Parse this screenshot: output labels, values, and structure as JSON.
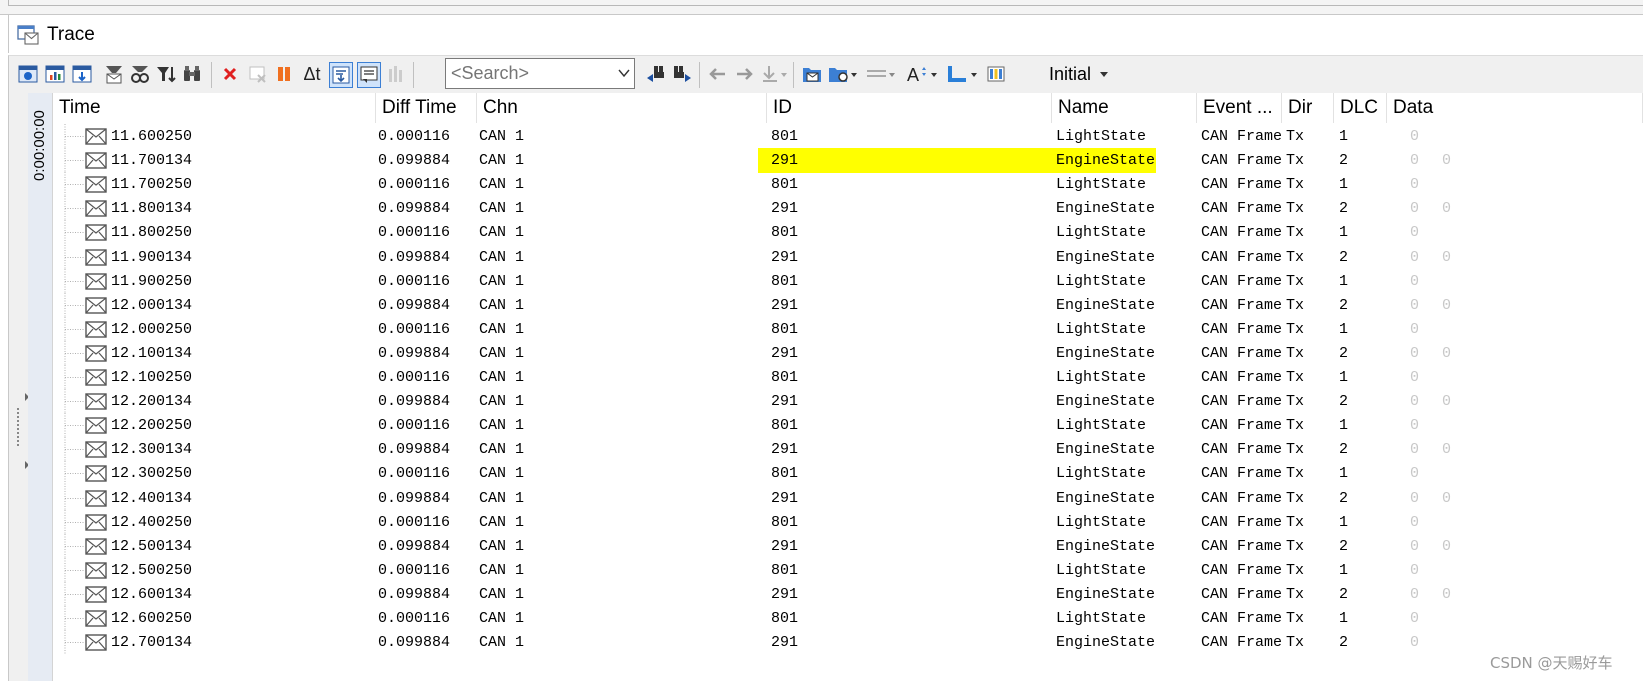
{
  "window": {
    "title": "Trace"
  },
  "toolbar": {
    "search_placeholder": "<Search>",
    "initial_label": "Initial",
    "delta_t_label": "Δt"
  },
  "time_strip": {
    "label": "0:00:00:00"
  },
  "columns": [
    "Time",
    "Diff Time",
    "Chn",
    "ID",
    "Name",
    "Event ...",
    "Dir",
    "DLC",
    "Data"
  ],
  "rows": [
    {
      "time": "11.600250",
      "diff": "0.000116",
      "chn": "CAN 1",
      "id": "801",
      "name": "LightState",
      "event": "CAN Frame",
      "dir": "Tx",
      "dlc": "1",
      "data": [
        "0"
      ],
      "highlight": false
    },
    {
      "time": "11.700134",
      "diff": "0.099884",
      "chn": "CAN 1",
      "id": "291",
      "name": "EngineState",
      "event": "CAN Frame",
      "dir": "Tx",
      "dlc": "2",
      "data": [
        "0",
        "0"
      ],
      "highlight": true
    },
    {
      "time": "11.700250",
      "diff": "0.000116",
      "chn": "CAN 1",
      "id": "801",
      "name": "LightState",
      "event": "CAN Frame",
      "dir": "Tx",
      "dlc": "1",
      "data": [
        "0"
      ],
      "highlight": false
    },
    {
      "time": "11.800134",
      "diff": "0.099884",
      "chn": "CAN 1",
      "id": "291",
      "name": "EngineState",
      "event": "CAN Frame",
      "dir": "Tx",
      "dlc": "2",
      "data": [
        "0",
        "0"
      ],
      "highlight": false
    },
    {
      "time": "11.800250",
      "diff": "0.000116",
      "chn": "CAN 1",
      "id": "801",
      "name": "LightState",
      "event": "CAN Frame",
      "dir": "Tx",
      "dlc": "1",
      "data": [
        "0"
      ],
      "highlight": false
    },
    {
      "time": "11.900134",
      "diff": "0.099884",
      "chn": "CAN 1",
      "id": "291",
      "name": "EngineState",
      "event": "CAN Frame",
      "dir": "Tx",
      "dlc": "2",
      "data": [
        "0",
        "0"
      ],
      "highlight": false
    },
    {
      "time": "11.900250",
      "diff": "0.000116",
      "chn": "CAN 1",
      "id": "801",
      "name": "LightState",
      "event": "CAN Frame",
      "dir": "Tx",
      "dlc": "1",
      "data": [
        "0"
      ],
      "highlight": false
    },
    {
      "time": "12.000134",
      "diff": "0.099884",
      "chn": "CAN 1",
      "id": "291",
      "name": "EngineState",
      "event": "CAN Frame",
      "dir": "Tx",
      "dlc": "2",
      "data": [
        "0",
        "0"
      ],
      "highlight": false
    },
    {
      "time": "12.000250",
      "diff": "0.000116",
      "chn": "CAN 1",
      "id": "801",
      "name": "LightState",
      "event": "CAN Frame",
      "dir": "Tx",
      "dlc": "1",
      "data": [
        "0"
      ],
      "highlight": false
    },
    {
      "time": "12.100134",
      "diff": "0.099884",
      "chn": "CAN 1",
      "id": "291",
      "name": "EngineState",
      "event": "CAN Frame",
      "dir": "Tx",
      "dlc": "2",
      "data": [
        "0",
        "0"
      ],
      "highlight": false
    },
    {
      "time": "12.100250",
      "diff": "0.000116",
      "chn": "CAN 1",
      "id": "801",
      "name": "LightState",
      "event": "CAN Frame",
      "dir": "Tx",
      "dlc": "1",
      "data": [
        "0"
      ],
      "highlight": false
    },
    {
      "time": "12.200134",
      "diff": "0.099884",
      "chn": "CAN 1",
      "id": "291",
      "name": "EngineState",
      "event": "CAN Frame",
      "dir": "Tx",
      "dlc": "2",
      "data": [
        "0",
        "0"
      ],
      "highlight": false
    },
    {
      "time": "12.200250",
      "diff": "0.000116",
      "chn": "CAN 1",
      "id": "801",
      "name": "LightState",
      "event": "CAN Frame",
      "dir": "Tx",
      "dlc": "1",
      "data": [
        "0"
      ],
      "highlight": false
    },
    {
      "time": "12.300134",
      "diff": "0.099884",
      "chn": "CAN 1",
      "id": "291",
      "name": "EngineState",
      "event": "CAN Frame",
      "dir": "Tx",
      "dlc": "2",
      "data": [
        "0",
        "0"
      ],
      "highlight": false
    },
    {
      "time": "12.300250",
      "diff": "0.000116",
      "chn": "CAN 1",
      "id": "801",
      "name": "LightState",
      "event": "CAN Frame",
      "dir": "Tx",
      "dlc": "1",
      "data": [
        "0"
      ],
      "highlight": false
    },
    {
      "time": "12.400134",
      "diff": "0.099884",
      "chn": "CAN 1",
      "id": "291",
      "name": "EngineState",
      "event": "CAN Frame",
      "dir": "Tx",
      "dlc": "2",
      "data": [
        "0",
        "0"
      ],
      "highlight": false
    },
    {
      "time": "12.400250",
      "diff": "0.000116",
      "chn": "CAN 1",
      "id": "801",
      "name": "LightState",
      "event": "CAN Frame",
      "dir": "Tx",
      "dlc": "1",
      "data": [
        "0"
      ],
      "highlight": false
    },
    {
      "time": "12.500134",
      "diff": "0.099884",
      "chn": "CAN 1",
      "id": "291",
      "name": "EngineState",
      "event": "CAN Frame",
      "dir": "Tx",
      "dlc": "2",
      "data": [
        "0",
        "0"
      ],
      "highlight": false
    },
    {
      "time": "12.500250",
      "diff": "0.000116",
      "chn": "CAN 1",
      "id": "801",
      "name": "LightState",
      "event": "CAN Frame",
      "dir": "Tx",
      "dlc": "1",
      "data": [
        "0"
      ],
      "highlight": false
    },
    {
      "time": "12.600134",
      "diff": "0.099884",
      "chn": "CAN 1",
      "id": "291",
      "name": "EngineState",
      "event": "CAN Frame",
      "dir": "Tx",
      "dlc": "2",
      "data": [
        "0",
        "0"
      ],
      "highlight": false
    },
    {
      "time": "12.600250",
      "diff": "0.000116",
      "chn": "CAN 1",
      "id": "801",
      "name": "LightState",
      "event": "CAN Frame",
      "dir": "Tx",
      "dlc": "1",
      "data": [
        "0"
      ],
      "highlight": false
    },
    {
      "time": "12.700134",
      "diff": "0.099884",
      "chn": "CAN 1",
      "id": "291",
      "name": "EngineState",
      "event": "CAN Frame",
      "dir": "Tx",
      "dlc": "2",
      "data": [
        "0"
      ],
      "highlight": false
    }
  ],
  "watermark": "CSDN @天赐好车",
  "colors": {
    "highlight": "#ffff00",
    "data_grey": "#c8c8c8",
    "time_strip": "#e6ebf3"
  },
  "icons": [
    "trace-window-icon",
    "message-icon",
    "clear-icon",
    "pause-icon",
    "find-prev-icon",
    "find-next-icon",
    "back-arrow-icon",
    "forward-arrow-icon",
    "font-icon",
    "column-icon"
  ]
}
